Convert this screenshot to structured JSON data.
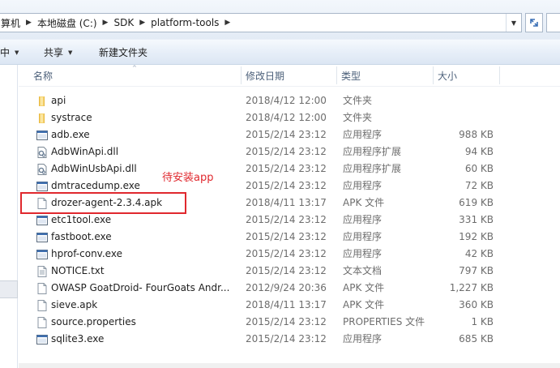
{
  "address": {
    "crumbs": [
      "算机",
      "本地磁盘 (C:)",
      "SDK",
      "platform-tools"
    ]
  },
  "toolbar": {
    "items": [
      {
        "label": "中",
        "has_dropdown": true
      },
      {
        "label": "共享",
        "has_dropdown": true
      },
      {
        "label": "新建文件夹",
        "has_dropdown": false
      }
    ]
  },
  "columns": {
    "name": "名称",
    "date": "修改日期",
    "type": "类型",
    "size": "大小"
  },
  "files": [
    {
      "name": "api",
      "date": "2018/4/12 12:00",
      "type": "文件夹",
      "size": "",
      "icon": "folder-icon"
    },
    {
      "name": "systrace",
      "date": "2018/4/12 12:00",
      "type": "文件夹",
      "size": "",
      "icon": "folder-icon"
    },
    {
      "name": "adb.exe",
      "date": "2015/2/14 23:12",
      "type": "应用程序",
      "size": "988 KB",
      "icon": "exe-icon"
    },
    {
      "name": "AdbWinApi.dll",
      "date": "2015/2/14 23:12",
      "type": "应用程序扩展",
      "size": "94 KB",
      "icon": "dll-icon"
    },
    {
      "name": "AdbWinUsbApi.dll",
      "date": "2015/2/14 23:12",
      "type": "应用程序扩展",
      "size": "60 KB",
      "icon": "dll-icon"
    },
    {
      "name": "dmtracedump.exe",
      "date": "2015/2/14 23:12",
      "type": "应用程序",
      "size": "72 KB",
      "icon": "exe-icon"
    },
    {
      "name": "drozer-agent-2.3.4.apk",
      "date": "2018/4/11 13:17",
      "type": "APK 文件",
      "size": "619 KB",
      "icon": "file-icon"
    },
    {
      "name": "etc1tool.exe",
      "date": "2015/2/14 23:12",
      "type": "应用程序",
      "size": "331 KB",
      "icon": "exe-icon"
    },
    {
      "name": "fastboot.exe",
      "date": "2015/2/14 23:12",
      "type": "应用程序",
      "size": "192 KB",
      "icon": "exe-icon"
    },
    {
      "name": "hprof-conv.exe",
      "date": "2015/2/14 23:12",
      "type": "应用程序",
      "size": "42 KB",
      "icon": "exe-icon"
    },
    {
      "name": "NOTICE.txt",
      "date": "2015/2/14 23:12",
      "type": "文本文档",
      "size": "797 KB",
      "icon": "text-file-icon"
    },
    {
      "name": "OWASP GoatDroid- FourGoats Andr...",
      "date": "2012/9/24 20:36",
      "type": "APK 文件",
      "size": "1,227 KB",
      "icon": "file-icon"
    },
    {
      "name": "sieve.apk",
      "date": "2018/4/11 13:17",
      "type": "APK 文件",
      "size": "360 KB",
      "icon": "file-icon"
    },
    {
      "name": "source.properties",
      "date": "2015/2/14 23:12",
      "type": "PROPERTIES 文件",
      "size": "1 KB",
      "icon": "file-icon"
    },
    {
      "name": "sqlite3.exe",
      "date": "2015/2/14 23:12",
      "type": "应用程序",
      "size": "685 KB",
      "icon": "exe-icon"
    }
  ],
  "annotation": {
    "label": "待安装app",
    "color": "#e0282e"
  }
}
